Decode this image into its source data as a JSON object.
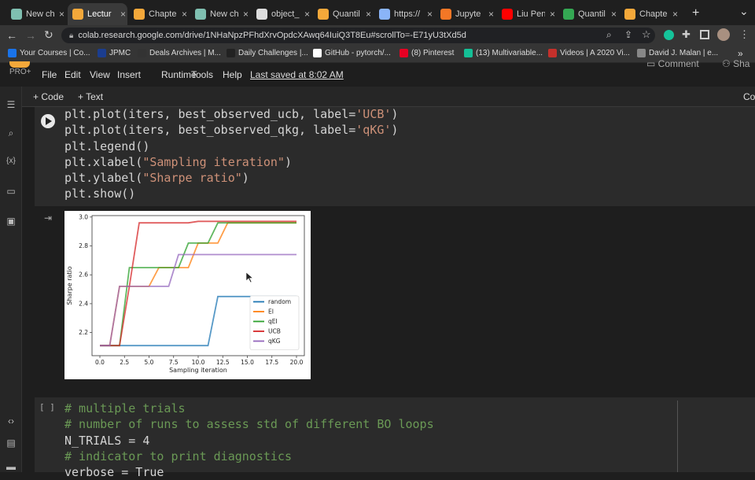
{
  "tabs": [
    {
      "label": "New ch",
      "icon": "doc-icon",
      "color": "#7fbfb0",
      "active": false
    },
    {
      "label": "Lectur",
      "icon": "colab-icon",
      "color": "#f4a83a",
      "active": true
    },
    {
      "label": "Chapte",
      "icon": "colab-icon",
      "color": "#f4a83a",
      "active": false
    },
    {
      "label": "New ch",
      "icon": "doc-icon",
      "color": "#7fbfb0",
      "active": false
    },
    {
      "label": "object_",
      "icon": "github-icon",
      "color": "#dddddd",
      "active": false
    },
    {
      "label": "Quantil",
      "icon": "colab-icon",
      "color": "#f4a83a",
      "active": false
    },
    {
      "label": "https://",
      "icon": "globe-icon",
      "color": "#8ab4f8",
      "active": false
    },
    {
      "label": "Jupyte",
      "icon": "jupyter-icon",
      "color": "#f37726",
      "active": false
    },
    {
      "label": "Liu Pen",
      "icon": "youtube-icon",
      "color": "#ff0000",
      "active": false
    },
    {
      "label": "Quantil",
      "icon": "drive-icon",
      "color": "#34a853",
      "active": false
    },
    {
      "label": "Chapte",
      "icon": "colab-icon",
      "color": "#f4a83a",
      "active": false
    }
  ],
  "toolbar": {
    "url": "colab.research.google.com/drive/1NHaNpzPFhdXrvOpdcXAwq64IuiQ3T8Eu#scrollTo=-E71yU3tXd5d"
  },
  "bookmarks": [
    {
      "label": "Your Courses | Co...",
      "color": "#1a73e8"
    },
    {
      "label": "JPMC",
      "color": "#1b3d8f"
    },
    {
      "label": "Deals Archives | M...",
      "color": "#333333"
    },
    {
      "label": "Daily Challenges |...",
      "color": "#222222"
    },
    {
      "label": "GitHub - pytorch/...",
      "color": "#ffffff"
    },
    {
      "label": "(8) Pinterest",
      "color": "#e60023"
    },
    {
      "label": "(13) Multivariable...",
      "color": "#14bf96"
    },
    {
      "label": "Videos | A 2020 Vi...",
      "color": "#c4302b"
    },
    {
      "label": "David J. Malan | e...",
      "color": "#888888"
    }
  ],
  "colab": {
    "badge": "PRO+",
    "menus": [
      "File",
      "Edit",
      "View",
      "Insert",
      "Runtime",
      "Tools",
      "Help"
    ],
    "last_saved": "Last saved at 8:02 AM",
    "comment": "Comment",
    "share": "Sha",
    "add_code": "+ Code",
    "add_text": "+ Text",
    "right_cut": "Co"
  },
  "cell1": {
    "lines": [
      {
        "pre": "plt.plot(iters, best_observed_ucb, label=",
        "str": "'UCB'",
        "post": ")"
      },
      {
        "pre": "plt.plot(iters, best_observed_qkg, label=",
        "str": "'qKG'",
        "post": ")"
      },
      {
        "pre": "plt.legend()",
        "str": "",
        "post": ""
      },
      {
        "pre": "plt.xlabel(",
        "str": "\"Sampling iteration\"",
        "post": ")"
      },
      {
        "pre": "plt.ylabel(",
        "str": "\"Sharpe ratio\"",
        "post": ")"
      },
      {
        "pre": "plt.show()",
        "str": "",
        "post": ""
      }
    ]
  },
  "cell2": {
    "bracket": "[ ]",
    "lines": [
      {
        "type": "cmt",
        "text": "# multiple trials"
      },
      {
        "type": "cmt",
        "text": "# number of runs to assess std of different BO loops"
      },
      {
        "type": "code",
        "text": "N_TRIALS = 4"
      },
      {
        "type": "cmt",
        "text": "# indicator to print diagnostics"
      },
      {
        "type": "code",
        "text": "verbose = True"
      }
    ]
  },
  "chart_data": {
    "type": "line",
    "title": "",
    "xlabel": "Sampling iteration",
    "ylabel": "Sharpe ratio",
    "xlim": [
      -0.8,
      20.8
    ],
    "ylim": [
      2.04,
      3.01
    ],
    "xticks": [
      "0.0",
      "2.5",
      "5.0",
      "7.5",
      "10.0",
      "12.5",
      "15.0",
      "17.5",
      "20.0"
    ],
    "yticks": [
      "2.2",
      "2.4",
      "2.6",
      "2.8",
      "3.0"
    ],
    "legend_position": "lower-right",
    "grid": false,
    "series": [
      {
        "name": "random",
        "color": "#1f77b4",
        "x": [
          0,
          1,
          2,
          3,
          4,
          5,
          6,
          7,
          8,
          9,
          10,
          11,
          12,
          13,
          14,
          15,
          16,
          17,
          18,
          19,
          20
        ],
        "y": [
          2.11,
          2.11,
          2.11,
          2.11,
          2.11,
          2.11,
          2.11,
          2.11,
          2.11,
          2.11,
          2.11,
          2.11,
          2.45,
          2.45,
          2.45,
          2.45,
          2.45,
          2.45,
          2.45,
          2.45,
          2.45
        ]
      },
      {
        "name": "EI",
        "color": "#ff7f0e",
        "x": [
          0,
          1,
          2,
          3,
          4,
          5,
          6,
          7,
          8,
          9,
          10,
          11,
          12,
          13,
          14,
          15,
          16,
          17,
          18,
          19,
          20
        ],
        "y": [
          2.11,
          2.11,
          2.52,
          2.52,
          2.52,
          2.52,
          2.65,
          2.65,
          2.65,
          2.65,
          2.82,
          2.82,
          2.82,
          2.96,
          2.96,
          2.96,
          2.96,
          2.96,
          2.96,
          2.96,
          2.96
        ]
      },
      {
        "name": "qEI",
        "color": "#2ca02c",
        "x": [
          0,
          1,
          2,
          3,
          4,
          5,
          6,
          7,
          8,
          9,
          10,
          11,
          12,
          13,
          14,
          15,
          16,
          17,
          18,
          19,
          20
        ],
        "y": [
          2.11,
          2.11,
          2.11,
          2.65,
          2.65,
          2.65,
          2.65,
          2.65,
          2.65,
          2.82,
          2.82,
          2.82,
          2.96,
          2.96,
          2.96,
          2.96,
          2.96,
          2.96,
          2.96,
          2.96,
          2.96
        ]
      },
      {
        "name": "UCB",
        "color": "#d62728",
        "x": [
          0,
          1,
          2,
          3,
          4,
          5,
          6,
          7,
          8,
          9,
          10,
          11,
          12,
          13,
          14,
          15,
          16,
          17,
          18,
          19,
          20
        ],
        "y": [
          2.11,
          2.11,
          2.11,
          2.52,
          2.96,
          2.96,
          2.96,
          2.96,
          2.96,
          2.96,
          2.97,
          2.97,
          2.97,
          2.97,
          2.97,
          2.97,
          2.97,
          2.97,
          2.97,
          2.97,
          2.97
        ]
      },
      {
        "name": "qKG",
        "color": "#9467bd",
        "x": [
          0,
          1,
          2,
          3,
          4,
          5,
          6,
          7,
          8,
          9,
          10,
          11,
          12,
          13,
          14,
          15,
          16,
          17,
          18,
          19,
          20
        ],
        "y": [
          2.11,
          2.11,
          2.52,
          2.52,
          2.52,
          2.52,
          2.52,
          2.52,
          2.74,
          2.74,
          2.74,
          2.74,
          2.74,
          2.74,
          2.74,
          2.74,
          2.74,
          2.74,
          2.74,
          2.74,
          2.74
        ]
      }
    ]
  }
}
